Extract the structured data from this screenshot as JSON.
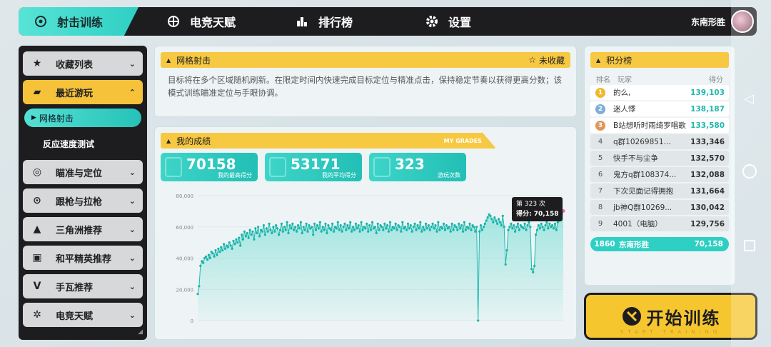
{
  "topnav": {
    "items": [
      {
        "label": "射击训练",
        "icon": "crosshair-icon"
      },
      {
        "label": "电竞天赋",
        "icon": "talent-icon"
      },
      {
        "label": "排行榜",
        "icon": "ranking-icon"
      },
      {
        "label": "设置",
        "icon": "gear-icon"
      }
    ],
    "user_name": "东南形胜"
  },
  "sidebar": {
    "items": [
      {
        "label": "收藏列表",
        "icon": "★"
      },
      {
        "label": "最近游玩",
        "icon": "🎮"
      },
      {
        "label": "瞄准与定位",
        "icon": "◎"
      },
      {
        "label": "跟枪与拉枪",
        "icon": "⊙"
      },
      {
        "label": "三角洲推荐",
        "icon": "▲"
      },
      {
        "label": "和平精英推荐",
        "icon": "▣"
      },
      {
        "label": "手瓦推荐",
        "icon": "V"
      },
      {
        "label": "电竞天赋",
        "icon": "✲"
      }
    ],
    "sub_active": "网格射击",
    "sub_other": "反应速度测试"
  },
  "mode": {
    "title": "网格射击",
    "favorite": "未收藏",
    "description": "目标将在多个区域随机刷新。在限定时间内快速完成目标定位与精准点击，保持稳定节奏以获得更高分数；该模式训练瞄准定位与手眼协调。"
  },
  "grades": {
    "title": "我的成绩",
    "title_en": "MY GRADES",
    "stats": [
      {
        "value": "70158",
        "label": "我的最高得分"
      },
      {
        "value": "53171",
        "label": "我的平均得分"
      },
      {
        "value": "323",
        "label": "游玩次数"
      }
    ],
    "tooltip_line1": "第 323 次",
    "tooltip_line2": "得分: 70,158"
  },
  "chart_data": {
    "type": "area",
    "ylim": [
      0,
      80000
    ],
    "y_ticks": [
      "80,000",
      "60,000",
      "40,000",
      "20,000",
      "0"
    ],
    "series": [
      {
        "values": [
          17000,
          22000,
          35000,
          38000,
          37000,
          40000,
          41000,
          39000,
          42000,
          40000,
          44000,
          43000,
          41000,
          45000,
          42000,
          46000,
          44000,
          47000,
          45000,
          49000,
          46000,
          48000,
          47000,
          50000,
          48000,
          46000,
          51000,
          49000,
          52000,
          50000,
          53000,
          48000,
          55000,
          52000,
          57000,
          54000,
          56000,
          53000,
          58000,
          55000,
          57000,
          52000,
          59000,
          56000,
          60000,
          54000,
          58000,
          57000,
          61000,
          55000,
          59000,
          57000,
          62000,
          58000,
          56000,
          60000,
          57000,
          61000,
          59000,
          55000,
          58000,
          62000,
          57000,
          60000,
          58000,
          63000,
          56000,
          61000,
          59000,
          62000,
          58000,
          60000,
          57000,
          61000,
          59000,
          63000,
          56000,
          60000,
          58000,
          62000,
          57000,
          61000,
          59000,
          60000,
          55000,
          62000,
          58000,
          61000,
          59000,
          63000,
          57000,
          60000,
          58000,
          62000,
          56000,
          61000,
          59000,
          58000,
          62000,
          57000,
          60000,
          59000,
          63000,
          58000,
          61000,
          57000,
          60000,
          62000,
          58000,
          61000,
          59000,
          63000,
          57000,
          60000,
          58000,
          62000,
          59000,
          61000,
          57000,
          63000,
          58000,
          60000,
          59000,
          62000,
          57000,
          61000,
          58000,
          63000,
          59000,
          60000,
          56000,
          62000,
          58000,
          61000,
          60000,
          58000,
          62000,
          59000,
          61000,
          57000,
          63000,
          58000,
          60000,
          59000,
          62000,
          58000,
          61000,
          60000,
          57000,
          63000,
          59000,
          60000,
          58000,
          62000,
          59000,
          61000,
          57000,
          60000,
          62000,
          58000,
          61000,
          59000,
          63000,
          57000,
          60000,
          58000,
          62000,
          59000,
          61000,
          58000,
          60000,
          62000,
          59000,
          61000,
          57000,
          63000,
          58000,
          60000,
          59000,
          62000,
          58000,
          61000,
          59000,
          60000,
          57000,
          62000,
          58000,
          61000,
          60000,
          58000,
          62000,
          59000,
          61000,
          57000,
          63000,
          58000,
          60000,
          59000,
          62000,
          58000,
          61000,
          60000,
          57000,
          60000,
          0,
          57000,
          61000,
          58000,
          60000,
          62000,
          64000,
          66000,
          68000,
          67000,
          65000,
          63000,
          66000,
          64000,
          62000,
          65000,
          63000,
          61000,
          67000,
          60000,
          36000,
          45000,
          58000,
          60000,
          62000,
          59000,
          61000,
          57000,
          60000,
          62000,
          58000,
          61000,
          60000,
          59000,
          62000,
          58000,
          61000,
          63000,
          60000,
          33000,
          31000,
          35000,
          55000,
          58000,
          61000,
          59000,
          62000,
          60000,
          58000,
          61000,
          63000,
          59000,
          62000,
          60000,
          61000,
          59000,
          62000,
          58000,
          63000,
          64000,
          65000,
          68000,
          70158
        ]
      }
    ]
  },
  "ranking": {
    "title": "积分榜",
    "col_rank": "排名",
    "col_player": "玩家",
    "col_score": "得分",
    "rows": [
      {
        "rank": "1",
        "name": "的么,",
        "score": "139,103"
      },
      {
        "rank": "2",
        "name": "迷人悸",
        "score": "138,187"
      },
      {
        "rank": "3",
        "name": "B站想听时雨绮罗唱歌",
        "score": "133,580"
      },
      {
        "rank": "4",
        "name": "q群10269851...",
        "score": "133,346"
      },
      {
        "rank": "5",
        "name": "快手不与尘争",
        "score": "132,570"
      },
      {
        "rank": "6",
        "name": "鬼方q群108374...",
        "score": "132,088"
      },
      {
        "rank": "7",
        "name": "下次见面记得拥抱",
        "score": "131,664"
      },
      {
        "rank": "8",
        "name": "jb神Q群10269...",
        "score": "130,042"
      },
      {
        "rank": "9",
        "name": "4001（电脑）",
        "score": "129,756"
      }
    ],
    "me": {
      "rank": "1860",
      "name": "东南形胜",
      "score": "70,158"
    }
  },
  "start": {
    "label": "开始训练",
    "sub": "START TRAINING"
  },
  "colors": {
    "accent": "#2fcfc4",
    "yellow": "#f6c62f",
    "dark": "#1d1d1f"
  }
}
